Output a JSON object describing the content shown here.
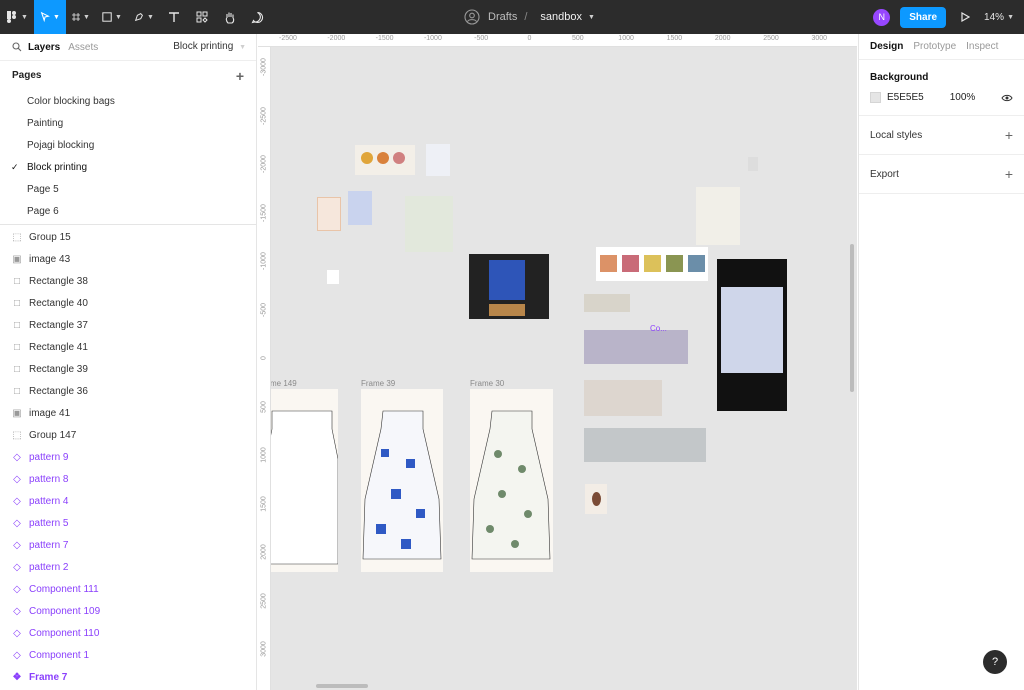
{
  "toolbar": {
    "breadcrumb_folder": "Drafts",
    "breadcrumb_sep": "/",
    "file_name": "sandbox",
    "avatar_initial": "N",
    "share_label": "Share",
    "zoom": "14%"
  },
  "left_panel": {
    "tab_layers": "Layers",
    "tab_assets": "Assets",
    "current_page": "Block printing",
    "pages_title": "Pages",
    "pages": [
      {
        "label": "Color blocking bags",
        "selected": false
      },
      {
        "label": "Painting",
        "selected": false
      },
      {
        "label": "Pojagi blocking",
        "selected": false
      },
      {
        "label": "Block printing",
        "selected": true
      },
      {
        "label": "Page 5",
        "selected": false
      },
      {
        "label": "Page 6",
        "selected": false
      }
    ],
    "layers": [
      {
        "label": "Group 15",
        "icon": "group-icon"
      },
      {
        "label": "image 43",
        "icon": "image-icon"
      },
      {
        "label": "Rectangle 38",
        "icon": "rectangle-icon"
      },
      {
        "label": "Rectangle 40",
        "icon": "rectangle-icon"
      },
      {
        "label": "Rectangle 37",
        "icon": "rectangle-icon"
      },
      {
        "label": "Rectangle 41",
        "icon": "rectangle-icon"
      },
      {
        "label": "Rectangle 39",
        "icon": "rectangle-icon"
      },
      {
        "label": "Rectangle 36",
        "icon": "rectangle-icon"
      },
      {
        "label": "image 41",
        "icon": "image-icon"
      },
      {
        "label": "Group 147",
        "icon": "group-icon"
      },
      {
        "label": "pattern 9",
        "icon": "instance-icon"
      },
      {
        "label": "pattern 8",
        "icon": "instance-icon"
      },
      {
        "label": "pattern 4",
        "icon": "instance-icon"
      },
      {
        "label": "pattern 5",
        "icon": "instance-icon"
      },
      {
        "label": "pattern 7",
        "icon": "instance-icon"
      },
      {
        "label": "pattern 2",
        "icon": "instance-icon"
      },
      {
        "label": "Component 111",
        "icon": "instance-icon"
      },
      {
        "label": "Component 109",
        "icon": "instance-icon"
      },
      {
        "label": "Component 110",
        "icon": "instance-icon"
      },
      {
        "label": "Component 1",
        "icon": "instance-icon"
      },
      {
        "label": "Frame 7",
        "icon": "component-icon"
      }
    ]
  },
  "canvas": {
    "ruler_x": [
      "-2500",
      "-2000",
      "-1500",
      "-1000",
      "-500",
      "0",
      "500",
      "1000",
      "1500",
      "2000",
      "2500",
      "3000"
    ],
    "ruler_y": [
      "-3000",
      "-2500",
      "-2000",
      "-1500",
      "-1000",
      "-500",
      "0",
      "500",
      "1000",
      "1500",
      "2000",
      "2500",
      "3000"
    ],
    "frames": [
      {
        "label": "me 149"
      },
      {
        "label": "Frame 39"
      },
      {
        "label": "Frame 30"
      }
    ],
    "mini_label": "Co..."
  },
  "right_panel": {
    "tab_design": "Design",
    "tab_prototype": "Prototype",
    "tab_inspect": "Inspect",
    "background_title": "Background",
    "bg_hex": "E5E5E5",
    "bg_opacity": "100%",
    "local_styles": "Local styles",
    "export": "Export",
    "help": "?"
  },
  "colors": {
    "toolbar_bg": "#2c2c2c",
    "accent": "#0d99ff",
    "component_purple": "#8a3ffc",
    "canvas_bg": "#e5e5e5"
  }
}
